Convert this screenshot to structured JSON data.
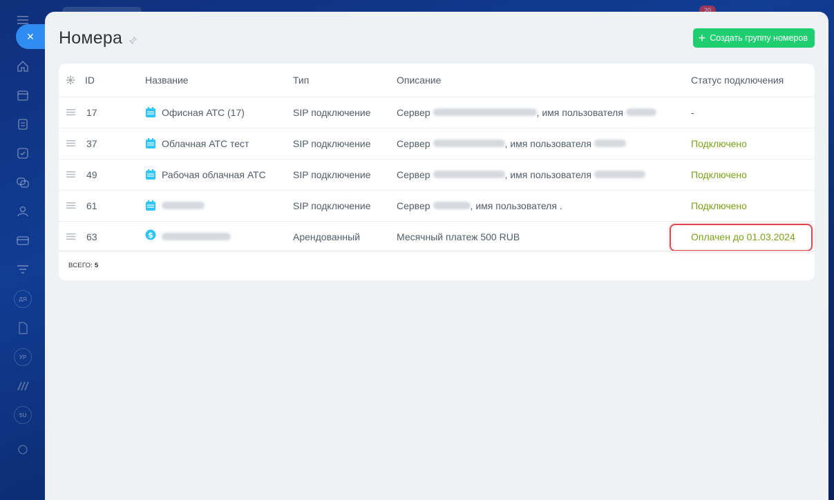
{
  "page": {
    "title": "Номера",
    "create_button": "Создать группу номеров",
    "close_label": "×"
  },
  "table": {
    "columns": {
      "id": "ID",
      "name": "Название",
      "type": "Тип",
      "description": "Описание",
      "status": "Статус подключения"
    },
    "rows": [
      {
        "id": "17",
        "name": "Офисная АТС (17)",
        "type": "SIP подключение",
        "desc_prefix": "Сервер",
        "desc_middle": ", имя пользователя",
        "desc_suffix": "",
        "status": "-",
        "icon": "pbx-icon"
      },
      {
        "id": "37",
        "name": "Облачная АТС тест",
        "type": "SIP подключение",
        "desc_prefix": "Сервер",
        "desc_middle": ", имя пользователя",
        "desc_suffix": "",
        "status": "Подключено",
        "icon": "pbx-icon"
      },
      {
        "id": "49",
        "name": "Рабочая облачная АТС",
        "type": "SIP подключение",
        "desc_prefix": "Сервер",
        "desc_middle": ", имя пользователя",
        "desc_suffix": "",
        "status": "Подключено",
        "icon": "pbx-icon"
      },
      {
        "id": "61",
        "name": "",
        "type": "SIP подключение",
        "desc_prefix": "Сервер",
        "desc_middle": ", имя пользователя .",
        "desc_suffix": "",
        "status": "Подключено",
        "icon": "pbx-icon"
      },
      {
        "id": "63",
        "name": "",
        "type": "Арендованный",
        "desc_prefix": "Месячный платеж 500 RUB",
        "desc_middle": "",
        "desc_suffix": "",
        "status": "Оплачен до 01.03.2024",
        "icon": "dollar-icon"
      }
    ],
    "total_label": "ВСЕГО:",
    "total_value": "5"
  },
  "colors": {
    "accent_green": "#1fce70",
    "status_green": "#7aa21a",
    "highlight_red": "#e0484f",
    "icon_blue": "#2fc6f6"
  },
  "top_counter": "20"
}
